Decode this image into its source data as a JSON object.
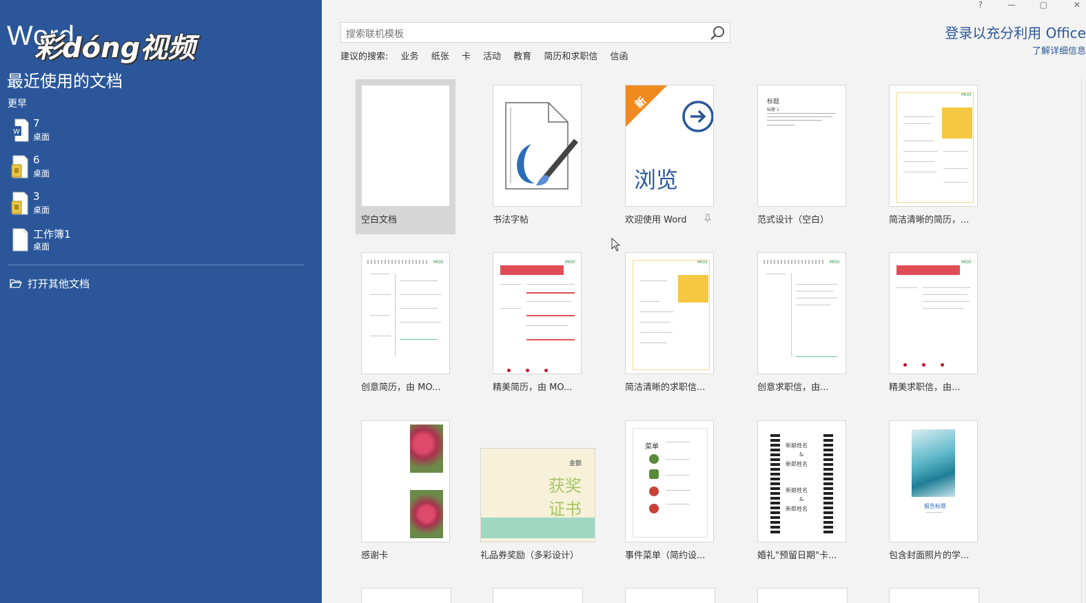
{
  "brand": {
    "app_word": "Word",
    "overlay": "彩dóng视频"
  },
  "left": {
    "title": "最近使用的文档",
    "group_label": "更早",
    "recent": [
      {
        "name": "7",
        "location": "桌面",
        "icon": "word-doc-icon"
      },
      {
        "name": "6",
        "location": "桌面",
        "icon": "locked-doc-icon"
      },
      {
        "name": "3",
        "location": "桌面",
        "icon": "locked-doc-icon"
      },
      {
        "name": "工作簿1",
        "location": "桌面",
        "icon": "blank-doc-icon"
      }
    ],
    "open_other": "打开其他文档"
  },
  "search": {
    "placeholder": "搜索联机模板"
  },
  "suggested": {
    "label": "建议的搜索:",
    "items": [
      "业务",
      "纸张",
      "卡",
      "活动",
      "教育",
      "简历和求职信",
      "信函"
    ]
  },
  "account": {
    "signin": "登录以充分利用 Office",
    "details": "了解详细信息"
  },
  "window_controls": [
    "?",
    "—",
    "▢",
    "✕"
  ],
  "templates": [
    {
      "caption": "空白文档"
    },
    {
      "caption": "书法字帖"
    },
    {
      "caption": "欢迎使用 Word",
      "badge": "新",
      "browse": "浏览"
    },
    {
      "caption": "范式设计（空白）",
      "thumb_title": "标题",
      "thumb_sub": "标题 1"
    },
    {
      "caption": "简洁清晰的简历，..."
    },
    {
      "caption": "创意简历，由 MO..."
    },
    {
      "caption": "精美简历，由 MO..."
    },
    {
      "caption": "简洁清晰的求职信..."
    },
    {
      "caption": "创意求职信，由..."
    },
    {
      "caption": "精美求职信，由..."
    },
    {
      "caption": "感谢卡"
    },
    {
      "caption": "礼品券奖励（多彩设计）",
      "thumb_top": "金额",
      "thumb_line1": "获奖",
      "thumb_line2": "证书"
    },
    {
      "caption": "事件菜单（简约设...",
      "thumb_title": "菜单"
    },
    {
      "caption": "婚礼\"预留日期\"卡...",
      "thumb_a": "新娘姓名",
      "thumb_amp": "&",
      "thumb_b": "新郎姓名"
    },
    {
      "caption": "包含封面照片的学...",
      "thumb_title": "报告标题"
    }
  ],
  "moo_label": "MOO",
  "colors": {
    "accent": "#2b579a",
    "red": "#e04c55",
    "yellow": "#f5c842"
  }
}
